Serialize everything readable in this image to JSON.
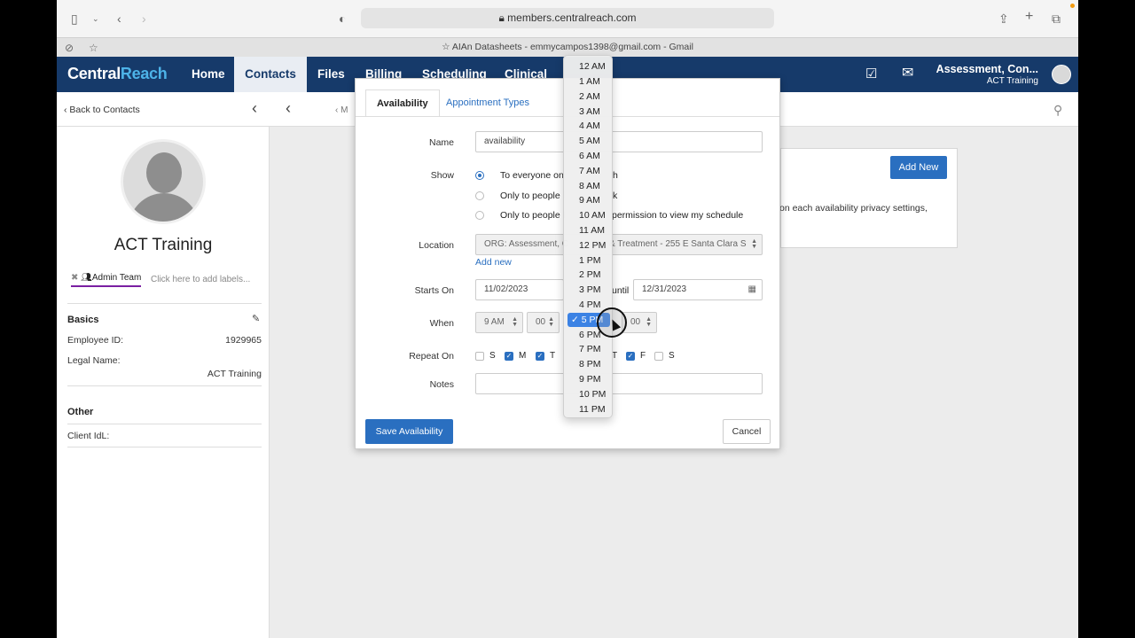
{
  "browser": {
    "url": "members.centralreach.com",
    "tab_title": "AIAn Datasheets - emmycampos1398@gmail.com - Gmail"
  },
  "app": {
    "logo_a": "Central",
    "logo_b": "Reach",
    "nav": [
      "Home",
      "Contacts",
      "Files",
      "Billing",
      "Scheduling",
      "Clinical"
    ],
    "active_nav": "Contacts",
    "account_title": "Assessment, Con...",
    "account_sub": "ACT Training"
  },
  "subheader": {
    "back": "Back to Contacts",
    "crumb": "M"
  },
  "profile": {
    "name": "ACT Training",
    "tag": "Admin Team",
    "add_label": "Click here to add labels...",
    "basics_title": "Basics",
    "employee_id_label": "Employee ID:",
    "employee_id": "1929965",
    "legal_name_label": "Legal Name:",
    "legal_name": "ACT Training",
    "other_title": "Other",
    "client_id_label": "Client IdL:"
  },
  "background": {
    "add_new": "Add New",
    "privacy_text": "on each availability privacy settings,"
  },
  "modal": {
    "tab_availability": "Availability",
    "tab_appointment_types": "Appointment Types",
    "name_label": "Name",
    "name_value": "availability",
    "show_label": "Show",
    "show_opt1_a": "To everyone on",
    "show_opt1_b": "h",
    "show_opt2_a": "Only to people i",
    "show_opt2_b": "k",
    "show_opt3_a": "Only to people l",
    "show_opt3_b": "permission to view my schedule",
    "location_label": "Location",
    "location_a": "ORG: Assessment, C",
    "location_b": "& Treatment - 255 E Santa Clara S",
    "add_new_link": "Add new",
    "starts_on_label": "Starts On",
    "starts_on": "11/02/2023",
    "until_label": "until",
    "until": "12/31/2023",
    "when_label": "When",
    "when_start_hour": "9 AM",
    "when_start_min": "00",
    "when_end_min": "00",
    "repeat_label": "Repeat On",
    "days": [
      {
        "label": "S",
        "checked": false
      },
      {
        "label": "M",
        "checked": true
      },
      {
        "label": "T",
        "checked": true
      },
      {
        "label": "T",
        "checked": true
      },
      {
        "label": "F",
        "checked": true
      },
      {
        "label": "S",
        "checked": false
      }
    ],
    "notes_label": "Notes",
    "save": "Save Availability",
    "cancel": "Cancel"
  },
  "dropdown": {
    "options": [
      "12 AM",
      "1 AM",
      "2 AM",
      "3 AM",
      "4 AM",
      "5 AM",
      "6 AM",
      "7 AM",
      "8 AM",
      "9 AM",
      "10 AM",
      "11 AM",
      "12 PM",
      "1 PM",
      "2 PM",
      "3 PM",
      "4 PM",
      "5 PM",
      "6 PM",
      "7 PM",
      "8 PM",
      "9 PM",
      "10 PM",
      "11 PM"
    ],
    "selected": "5 PM"
  }
}
